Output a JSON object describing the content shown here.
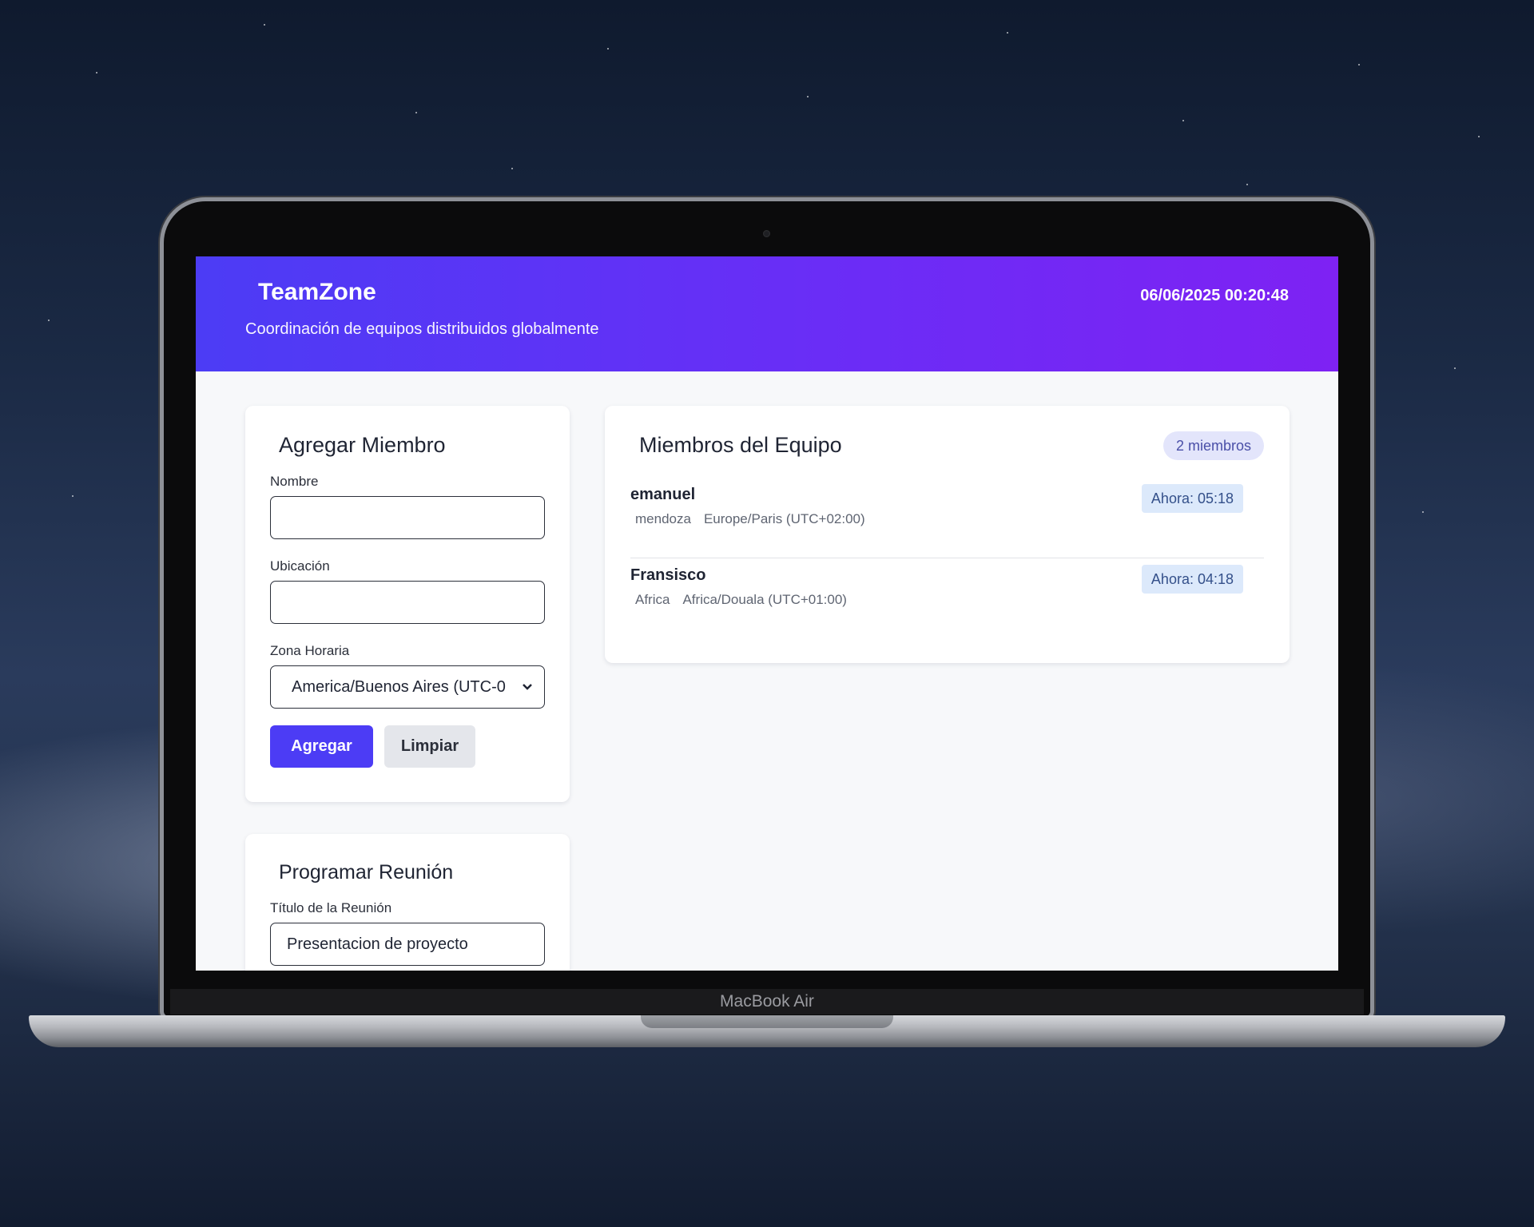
{
  "device_label": "MacBook Air",
  "header": {
    "brand": "TeamZone",
    "tagline": "Coordinación de equipos distribuidos globalmente",
    "datetime": "06/06/2025 00:20:48"
  },
  "add_member": {
    "title": "Agregar Miembro",
    "name_label": "Nombre",
    "name_value": "",
    "location_label": "Ubicación",
    "location_value": "",
    "timezone_label": "Zona Horaria",
    "timezone_selected": "America/Buenos Aires (UTC-0",
    "add_button": "Agregar",
    "clear_button": "Limpiar"
  },
  "schedule": {
    "title": "Programar Reunión",
    "meeting_title_label": "Título de la Reunión",
    "meeting_title_value": "Presentacion de proyecto"
  },
  "team": {
    "title": "Miembros del Equipo",
    "count": "2 miembros",
    "members": [
      {
        "name": "emanuel",
        "location": "mendoza",
        "timezone": "Europe/Paris (UTC+02:00)",
        "now": "Ahora: 05:18"
      },
      {
        "name": "Fransisco",
        "location": "Africa",
        "timezone": "Africa/Douala (UTC+01:00)",
        "now": "Ahora: 04:18"
      }
    ]
  },
  "colors": {
    "primary": "#4c3cf5",
    "header_gradient_end": "#7e22f3",
    "badge_bg": "#dce9fb"
  }
}
